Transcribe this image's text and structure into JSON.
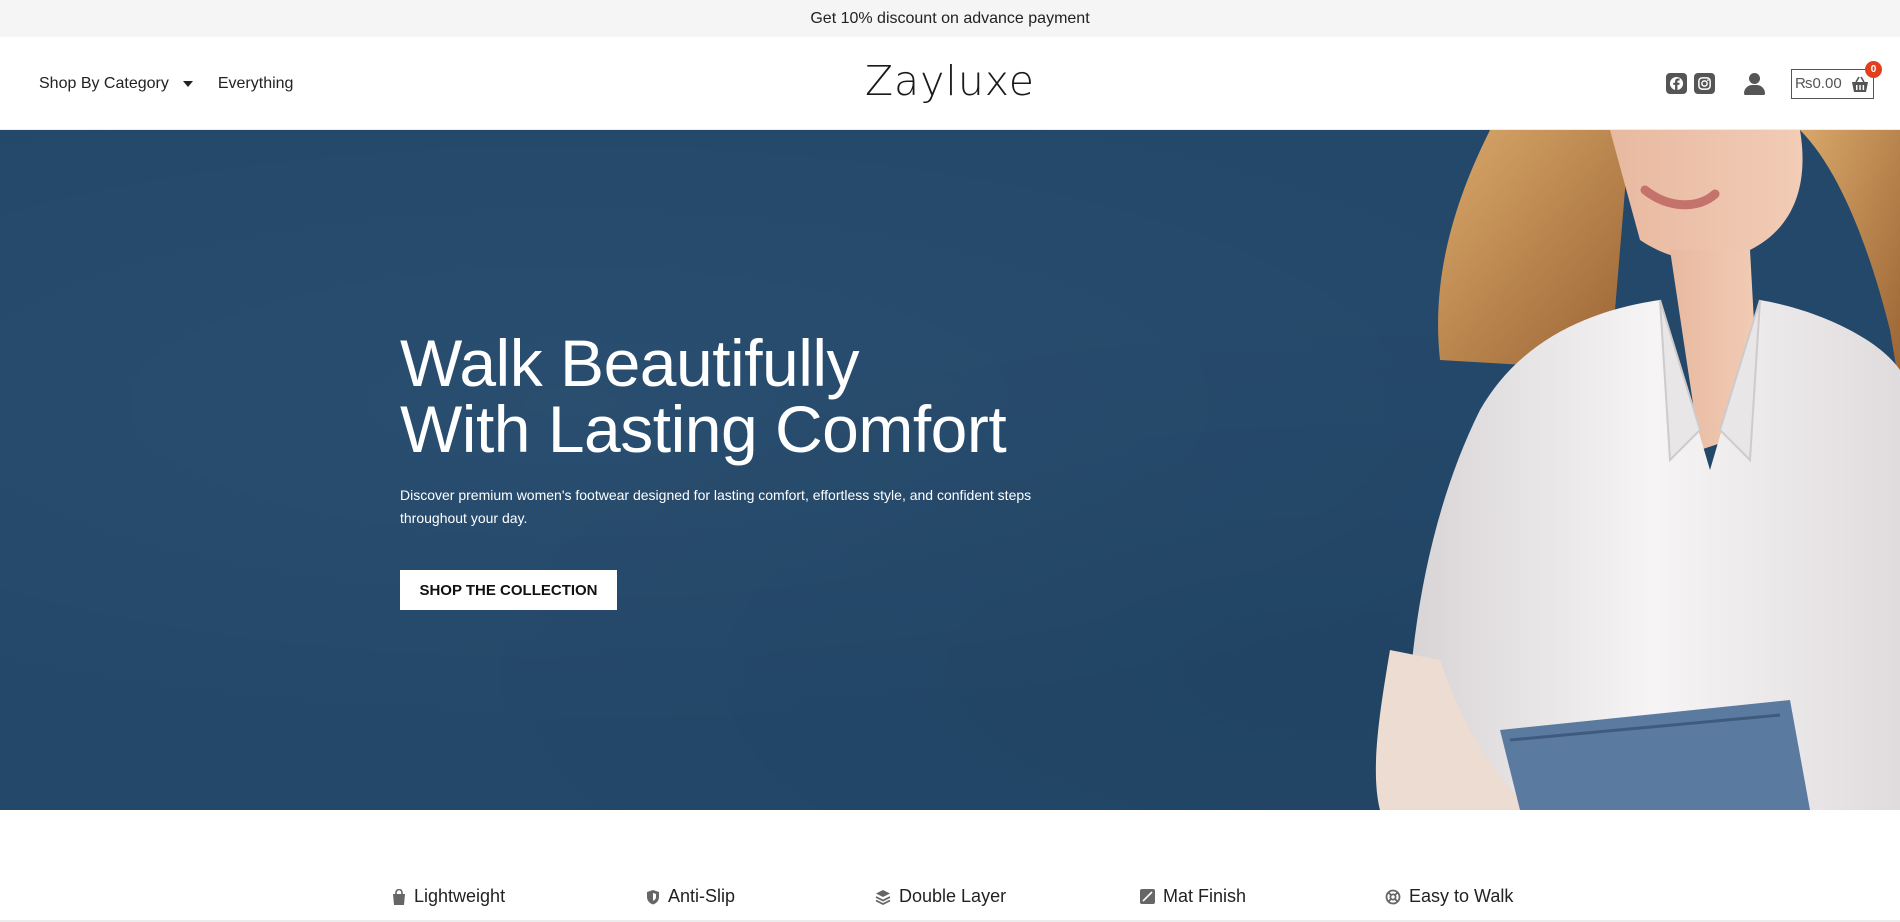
{
  "announcement": "Get 10% discount on advance payment",
  "header": {
    "nav": [
      {
        "label": "Shop By Category",
        "has_dropdown": true
      },
      {
        "label": "Everything",
        "has_dropdown": false
      }
    ],
    "logo": "Zayluxe",
    "icons": [
      "facebook-icon",
      "instagram-icon",
      "user-icon",
      "cart-icon"
    ],
    "cart": {
      "amount": "₨0.00",
      "count": "0"
    }
  },
  "hero": {
    "title_line1": "Walk Beautifully",
    "title_line2": "With Lasting Comfort",
    "subtitle": "Discover premium women's footwear designed for lasting comfort, effortless style, and confident steps throughout your day.",
    "button": "SHOP THE COLLECTION",
    "background_color": "#23486a"
  },
  "features": [
    {
      "label": "Lightweight",
      "icon": "bag-icon"
    },
    {
      "label": "Anti-Slip",
      "icon": "shield-icon"
    },
    {
      "label": "Double Layer",
      "icon": "layers-icon"
    },
    {
      "label": "Mat Finish",
      "icon": "leaf-icon"
    },
    {
      "label": "Easy to Walk",
      "icon": "lifebuoy-icon"
    }
  ]
}
